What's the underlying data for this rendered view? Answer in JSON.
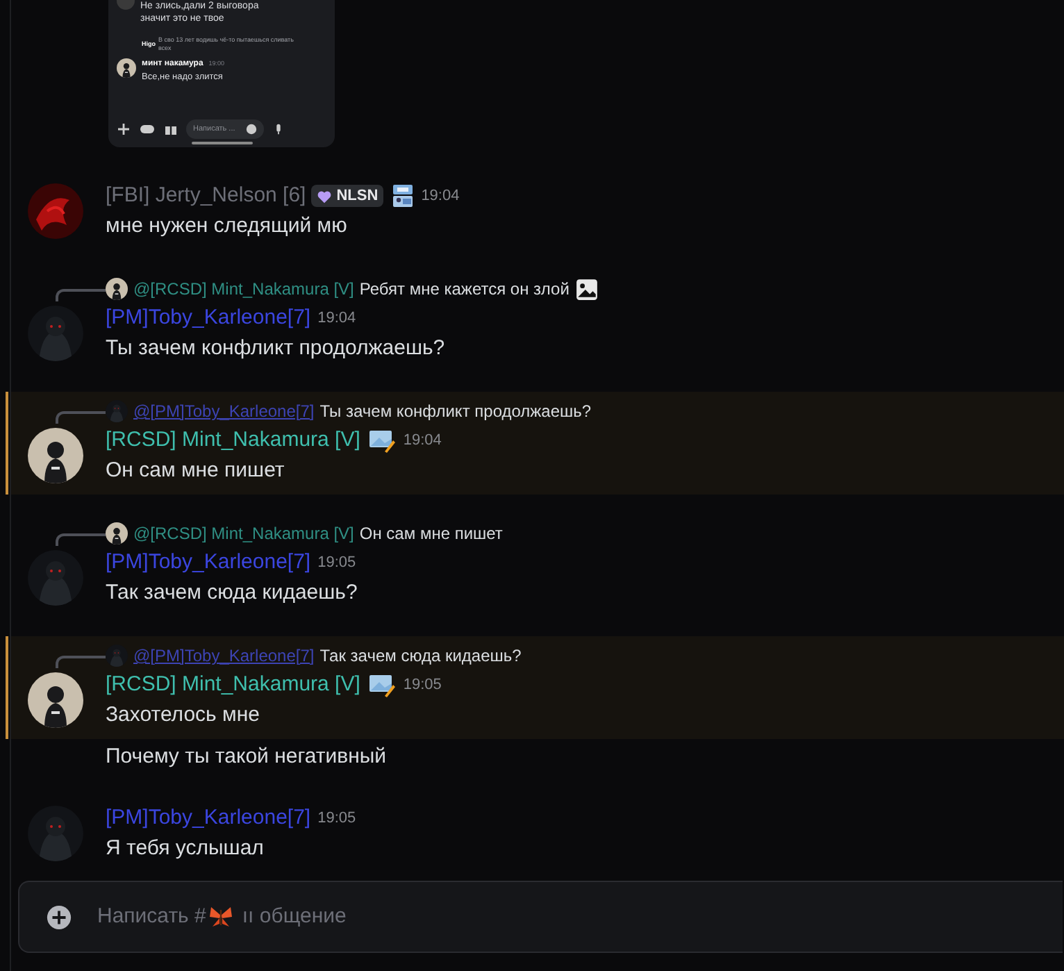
{
  "screenshot_preview": {
    "top_text": "Не злись,дали 2 выговора значит это не твое",
    "reply_author": "Higo",
    "reply_text": "В сво 13 лет водишь чё-то пытаешься сливать всех",
    "author": "минт накамура",
    "time": "19:00",
    "text": "Все,не надо злится",
    "composer_placeholder": "Написать ..."
  },
  "messages": [
    {
      "kind": "full",
      "author": "[FBI] Jerty_Nelson [6]",
      "color": "#6d6f78",
      "tag": "NLSN",
      "role_icon": true,
      "time": "19:04",
      "mentioned": false,
      "text": "мне нужен следящий мю"
    },
    {
      "kind": "full",
      "author": "[PM]Toby_Karleone[7]",
      "color": "#3b46e0",
      "role_icon": false,
      "time": "19:04",
      "mentioned": false,
      "text": "Ты зачем конфликт продолжаешь?",
      "reply": {
        "author": "@[RCSD] Mint_Nakamura [V]",
        "color": "#2f8f84",
        "underlined": false,
        "text": "Ребят мне кажется он злой",
        "attachment": true
      }
    },
    {
      "kind": "full",
      "author": "[RCSD] Mint_Nakamura [V]",
      "color": "#3fbfae",
      "role_icon": true,
      "time": "19:04",
      "mentioned": true,
      "text": "Он сам мне пишет",
      "reply": {
        "author": "@[PM]Toby_Karleone[7]",
        "color": "#3d44b4",
        "underlined": true,
        "text": "Ты зачем конфликт продолжаешь?",
        "attachment": false
      }
    },
    {
      "kind": "full",
      "author": "[PM]Toby_Karleone[7]",
      "color": "#3b46e0",
      "role_icon": false,
      "time": "19:05",
      "mentioned": false,
      "text": "Так зачем сюда кидаешь?",
      "reply": {
        "author": "@[RCSD] Mint_Nakamura [V]",
        "color": "#2f8f84",
        "underlined": false,
        "text": "Он сам мне пишет",
        "attachment": false
      }
    },
    {
      "kind": "full",
      "author": "[RCSD] Mint_Nakamura [V]",
      "color": "#3fbfae",
      "role_icon": true,
      "time": "19:05",
      "mentioned": true,
      "text": "Захотелось мне",
      "reply": {
        "author": "@[PM]Toby_Karleone[7]",
        "color": "#3d44b4",
        "underlined": true,
        "text": "Так зачем сюда кидаешь?",
        "attachment": false
      }
    },
    {
      "kind": "continuation",
      "mentioned": false,
      "text": "Почему ты такой негативный"
    },
    {
      "kind": "full",
      "author": "[PM]Toby_Karleone[7]",
      "color": "#3b46e0",
      "role_icon": false,
      "time": "19:05",
      "mentioned": false,
      "text": "Я тебя услышал"
    }
  ],
  "composer": {
    "placeholder": "Написать #",
    "channel": "ıı общение"
  }
}
